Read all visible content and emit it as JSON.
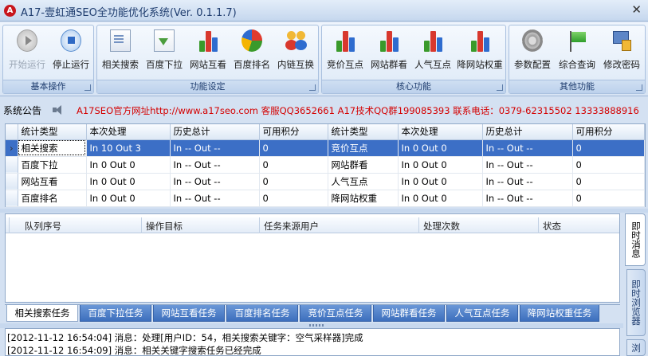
{
  "window": {
    "logo": "A",
    "title": "A17-壹虹通SEO全功能优化系统(Ver. 0.1.1.7)",
    "close_glyph": "✕"
  },
  "ribbon": {
    "groups": [
      {
        "caption": "基本操作",
        "buttons": [
          {
            "label": "开始运行",
            "icon": "play-icon",
            "enabled": false
          },
          {
            "label": "停止运行",
            "icon": "stop-icon",
            "enabled": true
          }
        ]
      },
      {
        "caption": "功能设定",
        "buttons": [
          {
            "label": "相关搜索",
            "icon": "document-list-icon"
          },
          {
            "label": "百度下拉",
            "icon": "download-icon"
          },
          {
            "label": "网站互看",
            "icon": "bar-chart-icon"
          },
          {
            "label": "百度排名",
            "icon": "pie-chart-icon"
          },
          {
            "label": "内链互换",
            "icon": "people-icon"
          }
        ]
      },
      {
        "caption": "核心功能",
        "buttons": [
          {
            "label": "竞价互点",
            "icon": "bar-chart-icon"
          },
          {
            "label": "网站群看",
            "icon": "bar-chart-icon"
          },
          {
            "label": "人气互点",
            "icon": "bar-chart-icon"
          },
          {
            "label": "降网站权重",
            "icon": "bar-chart-icon"
          }
        ]
      },
      {
        "caption": "其他功能",
        "buttons": [
          {
            "label": "参数配置",
            "icon": "gear-icon"
          },
          {
            "label": "综合查询",
            "icon": "flag-icon"
          },
          {
            "label": "修改密码",
            "icon": "lock-icon"
          }
        ]
      }
    ]
  },
  "notice": {
    "label": "系统公告",
    "text": "A17SEO官方网址http://www.a17seo.com 客服QQ3652661 A17技术QQ群199085393 联系电话：0379-62315502 13333888916"
  },
  "stats": {
    "headers": [
      "统计类型",
      "本次处理",
      "历史总计",
      "可用积分",
      "统计类型",
      "本次处理",
      "历史总计",
      "可用积分"
    ],
    "selected_marker": "›",
    "rows": [
      [
        "相关搜索",
        "In 10    Out 3",
        "In --    Out --",
        "0",
        "竞价互点",
        "In 0    Out 0",
        "In --    Out --",
        "0"
      ],
      [
        "百度下拉",
        "In 0    Out 0",
        "In --    Out --",
        "0",
        "网站群看",
        "In 0    Out 0",
        "In --    Out --",
        "0"
      ],
      [
        "网站互看",
        "In 0    Out 0",
        "In --    Out --",
        "0",
        "人气互点",
        "In 0    Out 0",
        "In --    Out --",
        "0"
      ],
      [
        "百度排名",
        "In 0    Out 0",
        "In --    Out --",
        "0",
        "降网站权重",
        "In 0    Out 0",
        "In --    Out --",
        "0"
      ]
    ]
  },
  "queue": {
    "headers": [
      "队列序号",
      "操作目标",
      "任务来源用户",
      "处理次数",
      "状态"
    ]
  },
  "side_tabs": [
    "即时消息",
    "即时浏览器",
    "浏"
  ],
  "bottom_tabs": [
    "相关搜索任务",
    "百度下拉任务",
    "网站互看任务",
    "百度排名任务",
    "竞价互点任务",
    "网站群看任务",
    "人气互点任务",
    "降网站权重任务"
  ],
  "log": [
    "[2012-11-12 16:54:04] 消息：处理[用户ID：54，相关搜索关键字：空气采样器]完成",
    "[2012-11-12 16:54:09] 消息：相关关键字搜索任务已经完成"
  ]
}
